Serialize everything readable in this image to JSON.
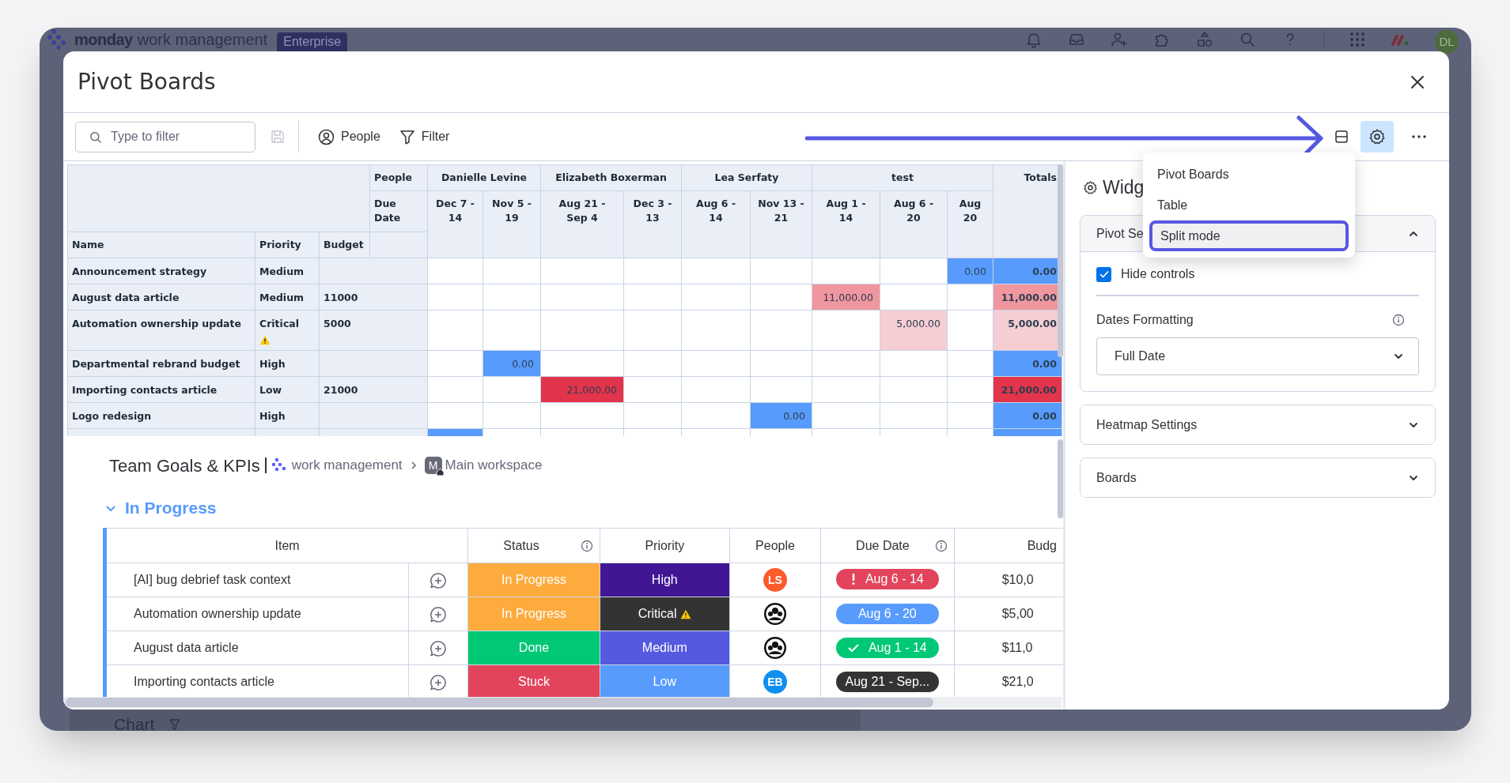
{
  "app_bar": {
    "logo_bold": "monday",
    "logo_rest": "work management",
    "plan_badge": "Enterprise",
    "avatar": "DL"
  },
  "modal": {
    "title": "Pivot Boards"
  },
  "toolbar": {
    "search": {
      "placeholder": "Type to filter"
    },
    "buttons": [
      {
        "label": "People",
        "kind": "person"
      },
      {
        "label": "Filter",
        "kind": "filter"
      }
    ],
    "settings_active": true
  },
  "view_menu": {
    "items": [
      {
        "label": "Pivot Boards",
        "selected": false
      },
      {
        "label": "Table",
        "selected": false
      },
      {
        "label": "Split mode",
        "selected": true
      }
    ]
  },
  "pivot": {
    "row_header_label": "People",
    "col_field_label": "Due Date",
    "row_fields": [
      "Name",
      "Priority",
      "Budget"
    ],
    "totals_label": "Totals",
    "groups": [
      {
        "name": "Danielle Levine",
        "columns": [
          "Dec 7 - 14",
          "Nov 5 - 19"
        ]
      },
      {
        "name": "Elizabeth Boxerman",
        "columns": [
          "Aug 21 - Sep 4",
          "Dec 3 - 13"
        ]
      },
      {
        "name": "Lea Serfaty",
        "columns": [
          "Aug 6 - 14",
          "Nov 13 - 21"
        ]
      },
      {
        "name": "test",
        "columns": [
          "Aug 1 - 14",
          "Aug 6 - 20",
          "Aug 20"
        ]
      }
    ],
    "rows": [
      {
        "name": "Announcement strategy",
        "priority": "Medium",
        "priority_alert": false,
        "cells": [
          null,
          null,
          null,
          null,
          null,
          null,
          null,
          null,
          {
            "text": "0.00",
            "color": "#579bfc"
          }
        ],
        "total": {
          "text": "0.00",
          "color": "#579bfc"
        }
      },
      {
        "name": "August data article",
        "priority": "Medium",
        "priority_alert": false,
        "budget": "11000",
        "cells": [
          null,
          null,
          null,
          null,
          null,
          null,
          {
            "text": "11,000.00",
            "color": "#f0969f"
          },
          null,
          null
        ],
        "total": {
          "text": "11,000.00",
          "color": "#f0969f"
        }
      },
      {
        "name": "Automation ownership update",
        "priority": "Critical",
        "priority_alert": true,
        "budget": "5000",
        "cells": [
          null,
          null,
          null,
          null,
          null,
          null,
          null,
          {
            "text": "5,000.00",
            "color": "#f6cdd3"
          },
          null
        ],
        "total": {
          "text": "5,000.00",
          "color": "#f6cdd3"
        }
      },
      {
        "name": "Departmental rebrand budget",
        "priority": "High",
        "priority_alert": false,
        "cells": [
          null,
          {
            "text": "0.00",
            "color": "#579bfc"
          },
          null,
          null,
          null,
          null,
          null,
          null,
          null
        ],
        "total": {
          "text": "0.00",
          "color": "#579bfc"
        }
      },
      {
        "name": "Importing contacts article",
        "priority": "Low",
        "priority_alert": false,
        "budget": "21000",
        "cells": [
          null,
          null,
          {
            "text": "21,000.00",
            "color": "#e2344b"
          },
          null,
          null,
          null,
          null,
          null,
          null
        ],
        "total": {
          "text": "21,000.00",
          "color": "#e2344b"
        }
      },
      {
        "name": "Logo redesign",
        "priority": "High",
        "priority_alert": false,
        "cells": [
          null,
          null,
          null,
          null,
          null,
          {
            "text": "0.00",
            "color": "#579bfc"
          },
          null,
          null,
          null
        ],
        "total": {
          "text": "0.00",
          "color": "#579bfc"
        }
      },
      {
        "cells": [
          {
            "color": "#579bfc"
          },
          null,
          null,
          null,
          null,
          null,
          null,
          null,
          null
        ],
        "total": {
          "color": "#579bfc"
        }
      }
    ]
  },
  "settings_panel": {
    "title": "Widg",
    "sections": [
      {
        "title": "Pivot Se",
        "expanded": true
      },
      {
        "title": "Heatmap Settings",
        "expanded": false
      },
      {
        "title": "Boards",
        "expanded": false
      }
    ],
    "hide_controls": {
      "label": "Hide controls",
      "checked": true
    },
    "dates_formatting": {
      "label": "Dates Formatting",
      "value": "Full Date"
    }
  },
  "board": {
    "title": "Team Goals & KPIs",
    "product": "work management",
    "workspace_initial": "M",
    "workspace": "Main workspace",
    "group": {
      "name": "In Progress",
      "expanded": true,
      "color": "#579bfc"
    },
    "columns": [
      {
        "label": "Item",
        "info": false
      },
      {
        "label": "Status",
        "info": true
      },
      {
        "label": "Priority",
        "info": false
      },
      {
        "label": "People",
        "info": false
      },
      {
        "label": "Due Date",
        "info": true
      },
      {
        "label": "Budg",
        "info": false
      }
    ],
    "rows": [
      {
        "item": "[AI] bug debrief task context",
        "status": {
          "label": "In Progress",
          "color": "#fdab3d"
        },
        "priority": {
          "label": "High",
          "color": "#401694",
          "alert": false
        },
        "person": {
          "kind": "initials",
          "initials": "LS",
          "color": "#fc5b2c"
        },
        "due": {
          "label": "Aug 6 - 14",
          "kind": "overdue",
          "color": "#e2445c"
        },
        "budget": "$10,0"
      },
      {
        "item": "Automation ownership update",
        "status": {
          "label": "In Progress",
          "color": "#fdab3d"
        },
        "priority": {
          "label": "Critical",
          "color": "#333333",
          "alert": true
        },
        "person": {
          "kind": "avatar"
        },
        "due": {
          "label": "Aug 6 - 20",
          "kind": "plain",
          "color": "#579bfc"
        },
        "budget": "$5,00"
      },
      {
        "item": "August data article",
        "status": {
          "label": "Done",
          "color": "#00c875"
        },
        "priority": {
          "label": "Medium",
          "color": "#5559df",
          "alert": false
        },
        "person": {
          "kind": "avatar"
        },
        "due": {
          "label": "Aug 1 - 14",
          "kind": "done",
          "color": "#00c875"
        },
        "budget": "$11,0"
      },
      {
        "item": "Importing contacts article",
        "status": {
          "label": "Stuck",
          "color": "#e2445c"
        },
        "priority": {
          "label": "Low",
          "color": "#579bfc",
          "alert": false
        },
        "person": {
          "kind": "initials",
          "initials": "EB",
          "color": "#0d8ff0"
        },
        "due": {
          "label": "Aug 21 - Sep...",
          "kind": "plain",
          "color": "#333333"
        },
        "budget": "$21,0"
      }
    ]
  },
  "background": {
    "widget_title": "Chart"
  }
}
